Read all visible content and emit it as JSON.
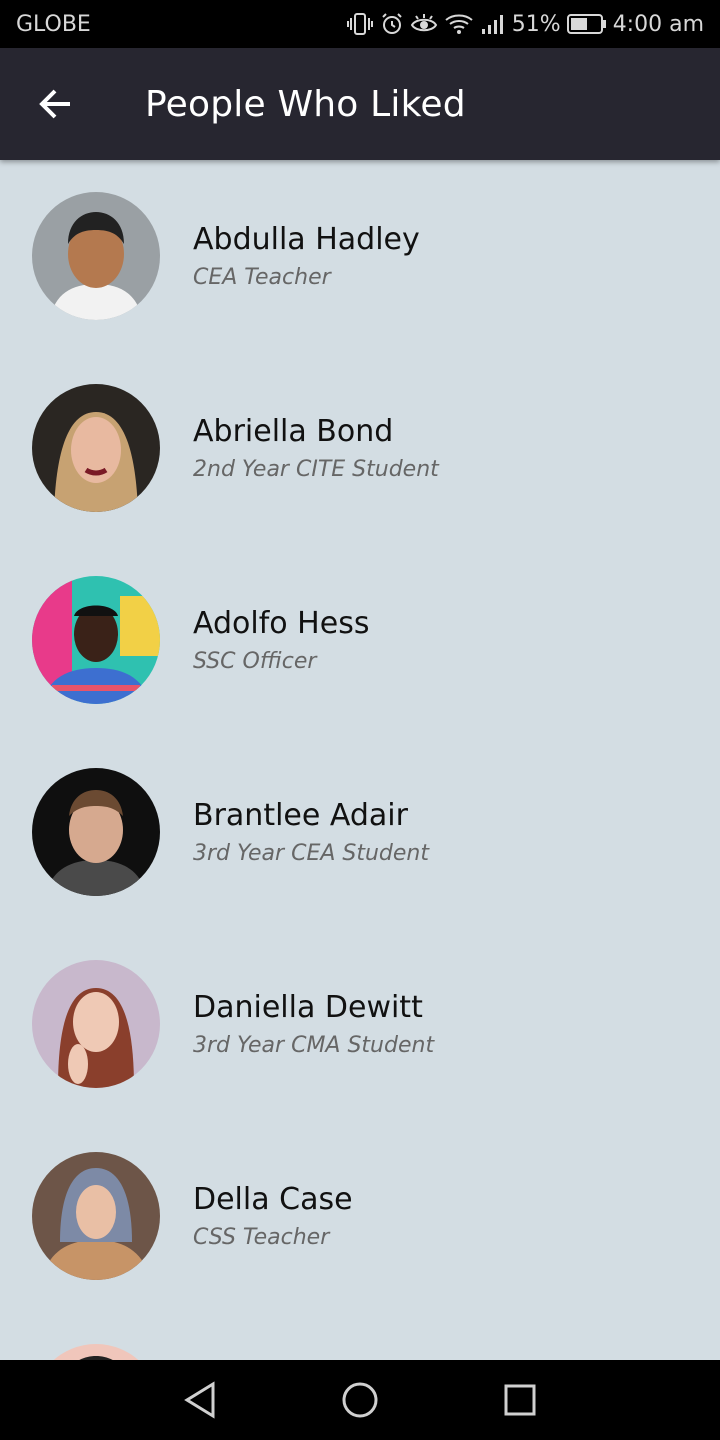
{
  "status_bar": {
    "carrier": "GLOBE",
    "battery": "51%",
    "time": "4:00 am",
    "icons": [
      "vibrate-icon",
      "alarm-icon",
      "eye-icon",
      "wifi-icon",
      "signal-icon",
      "battery-icon"
    ]
  },
  "header": {
    "title": "People Who Liked",
    "back_icon": "arrow-left-icon"
  },
  "people": [
    {
      "name": "Abdulla Hadley",
      "role": "CEA Teacher"
    },
    {
      "name": "Abriella Bond",
      "role": "2nd Year CITE Student"
    },
    {
      "name": "Adolfo Hess",
      "role": "SSC Officer"
    },
    {
      "name": "Brantlee Adair",
      "role": "3rd Year CEA Student"
    },
    {
      "name": "Daniella Dewitt",
      "role": "3rd Year CMA Student"
    },
    {
      "name": "Della Case",
      "role": "CSS Teacher"
    }
  ],
  "nav_bar": {
    "icons": [
      "back-triangle-icon",
      "home-circle-icon",
      "recents-square-icon"
    ]
  },
  "colors": {
    "app_bar": "#272630",
    "list_background": "#d3dde3",
    "status_bar": "#000000"
  }
}
